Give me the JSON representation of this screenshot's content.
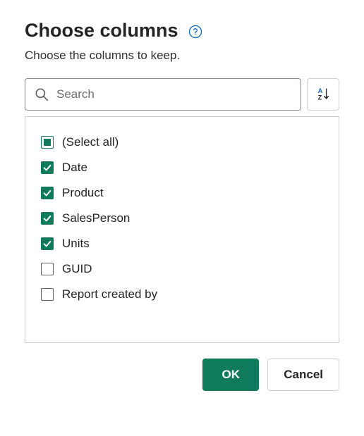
{
  "dialog": {
    "title": "Choose columns",
    "subtitle": "Choose the columns to keep."
  },
  "search": {
    "placeholder": "Search",
    "value": ""
  },
  "sort": {
    "aria": "Sort columns"
  },
  "columns": {
    "selectAll": {
      "label": "(Select all)",
      "state": "indeterminate"
    },
    "items": [
      {
        "label": "Date",
        "checked": true
      },
      {
        "label": "Product",
        "checked": true
      },
      {
        "label": "SalesPerson",
        "checked": true
      },
      {
        "label": "Units",
        "checked": true
      },
      {
        "label": "GUID",
        "checked": false
      },
      {
        "label": "Report created by",
        "checked": false
      }
    ]
  },
  "buttons": {
    "ok": "OK",
    "cancel": "Cancel"
  },
  "colors": {
    "accent": "#0f7b5c",
    "link": "#0f6cbd"
  }
}
